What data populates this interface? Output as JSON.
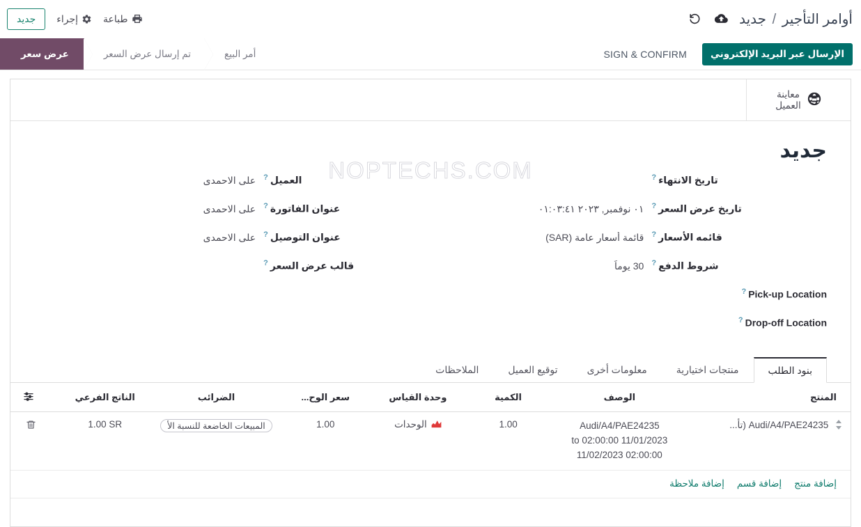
{
  "control_panel": {
    "breadcrumb": {
      "parent": "أوامر التأجير",
      "separator": "/",
      "current": "جديد"
    },
    "save_icon": "cloud-upload-icon",
    "discard_icon": "undo-icon",
    "new_button": "جديد",
    "action_button": "إجراء",
    "action_icon": "gear-icon",
    "print_button": "طباعة",
    "print_icon": "printer-icon"
  },
  "statusbar": {
    "buttons": {
      "send_by_email": "الإرسال عبر البريد الإلكتروني",
      "sign_and_confirm": "SIGN & CONFIRM"
    },
    "stages": [
      {
        "label": "عرض سعر",
        "state": "active"
      },
      {
        "label": "تم إرسال عرض السعر",
        "state": "inactive"
      },
      {
        "label": "أمر البيع",
        "state": "inactive"
      }
    ]
  },
  "stat_buttons": [
    {
      "label_line1": "معاينة",
      "label_line2": "العميل",
      "icon": "globe-icon"
    }
  ],
  "watermark": "NOPTECHS.COM",
  "record": {
    "title": "جديد",
    "right_fields": [
      {
        "label": "العميل",
        "value": "على الاحمدى",
        "help": "?"
      },
      {
        "label": "عنوان الفاتورة",
        "value": "على الاحمدى",
        "help": "?"
      },
      {
        "label": "عنوان التوصيل",
        "value": "على الاحمدى",
        "help": "?"
      },
      {
        "label": "قالب عرض السعر",
        "value": "",
        "help": "?"
      }
    ],
    "left_fields": [
      {
        "label": "تاريخ الانتهاء",
        "value": "",
        "help": "?",
        "dir": "rtl"
      },
      {
        "label": "تاريخ عرض السعر",
        "value": "٠١ نوفمبر, ٢٠٢٣ ٠١:٠٣:٤١",
        "help": "?",
        "dir": "rtl"
      },
      {
        "label": "قائمه الأسعار",
        "value": "قائمة أسعار عامة (SAR)",
        "help": "?",
        "dir": "rtl"
      },
      {
        "label": "شروط الدفع",
        "value": "30 يوماً",
        "help": "?",
        "dir": "rtl"
      },
      {
        "label": "Pick-up Location",
        "value": "",
        "help": "?",
        "dir": "ltr"
      },
      {
        "label": "Drop-off Location",
        "value": "",
        "help": "?",
        "dir": "ltr"
      }
    ]
  },
  "notebook": {
    "tabs": [
      {
        "label": "بنود الطلب",
        "active": true
      },
      {
        "label": "منتجات اختيارية",
        "active": false
      },
      {
        "label": "معلومات أخرى",
        "active": false
      },
      {
        "label": "توقيع العميل",
        "active": false
      },
      {
        "label": "الملاحظات",
        "active": false
      }
    ]
  },
  "lines_table": {
    "columns": {
      "product": "المنتج",
      "description": "الوصف",
      "quantity": "الكمية",
      "uom": "وحدة القياس",
      "unit_price": "سعر الوح...",
      "taxes": "الضرائب",
      "subtotal": "الناتج الفرعي",
      "options_icon": "column-settings-icon"
    },
    "rows": [
      {
        "drag_icon": "drag-handle-icon",
        "product": "Audi/A4/PAE24235 (تأ...",
        "description_line1": "Audi/A4/PAE24235",
        "description_line2": "to 02:00:00 11/01/2023",
        "description_line3": "11/02/2023 02:00:00",
        "quantity": "1.00",
        "uom": "الوحدات",
        "uom_icon": "area-chart-icon",
        "uom_icon_color": "#e03a3a",
        "unit_price": "1.00",
        "taxes": "المبيعات الخاضعة للنسبة الأ",
        "subtotal": "1.00 SR",
        "delete_icon": "trash-icon"
      }
    ],
    "add_links": [
      {
        "label": "إضافة منتج"
      },
      {
        "label": "إضافة قسم"
      },
      {
        "label": "إضافة ملاحظة"
      }
    ]
  },
  "colors": {
    "accent_teal": "#01706b",
    "status_active": "#714b67",
    "link_green": "#0e7b6c",
    "help_blue": "#5b9bb5",
    "uom_icon_red": "#e03a3a"
  }
}
